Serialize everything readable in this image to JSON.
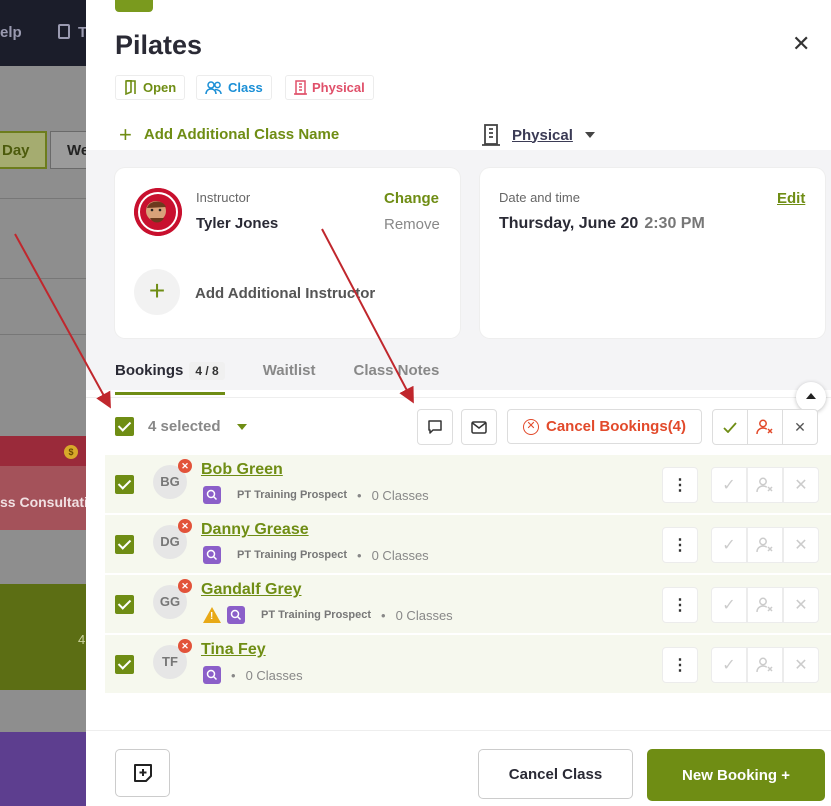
{
  "background": {
    "topbar_help": "elp",
    "topbar_t": "T",
    "day_button": "Day",
    "week_button": "We",
    "red_event_text": "ss Consultatio",
    "green_event_num": "4"
  },
  "panel": {
    "title": "Pilates",
    "tags": {
      "open": "Open",
      "class": "Class",
      "physical": "Physical"
    },
    "add_class_name": "Add Additional Class Name",
    "location": "Physical",
    "instructor": {
      "label": "Instructor",
      "name": "Tyler Jones",
      "change": "Change",
      "remove": "Remove",
      "add_additional": "Add Additional Instructor"
    },
    "datetime": {
      "label": "Date and time",
      "date": "Thursday, June 20",
      "time": "2:30 PM",
      "edit": "Edit"
    },
    "tabs": {
      "bookings": "Bookings",
      "bookings_count": "4 / 8",
      "waitlist": "Waitlist",
      "class_notes": "Class Notes"
    },
    "selection": {
      "text": "4 selected",
      "cancel_bookings": "Cancel Bookings(4)"
    },
    "bookings": [
      {
        "initials": "BG",
        "name": "Bob Green",
        "prospect": "PT Training Prospect",
        "classes": "0 Classes"
      },
      {
        "initials": "DG",
        "name": "Danny Grease",
        "prospect": "PT Training Prospect",
        "classes": "0 Classes"
      },
      {
        "initials": "GG",
        "name": "Gandalf Grey",
        "prospect": "PT Training Prospect",
        "classes": "0 Classes"
      },
      {
        "initials": "TF",
        "name": "Tina Fey",
        "prospect": "",
        "classes": "0 Classes"
      }
    ],
    "footer": {
      "cancel_class": "Cancel Class",
      "new_booking": "New Booking +"
    }
  },
  "colors": {
    "accent": "#6f8d14",
    "danger": "#e24a2b",
    "class_blue": "#1b8fd6",
    "physical_pink": "#e0506a",
    "prospect_purple": "#8b5fc9"
  }
}
